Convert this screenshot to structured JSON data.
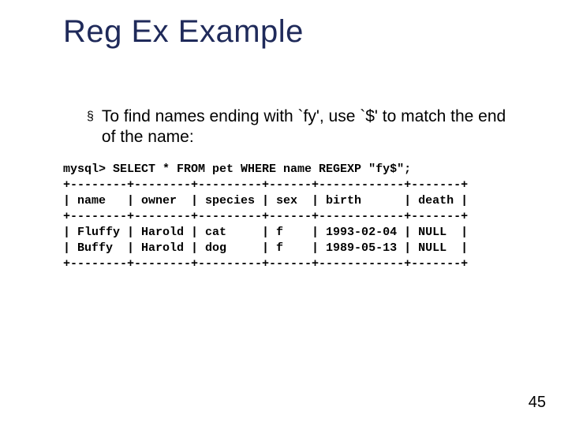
{
  "title": "Reg Ex Example",
  "bullet": {
    "marker": "§",
    "text": "To find names ending with `fy', use `$' to match the end of the name:"
  },
  "code": "mysql> SELECT * FROM pet WHERE name REGEXP \"fy$\";\n+--------+--------+---------+------+------------+-------+\n| name   | owner  | species | sex  | birth      | death |\n+--------+--------+---------+------+------------+-------+\n| Fluffy | Harold | cat     | f    | 1993-02-04 | NULL  |\n| Buffy  | Harold | dog     | f    | 1989-05-13 | NULL  |\n+--------+--------+---------+------+------------+-------+",
  "page_number": "45"
}
